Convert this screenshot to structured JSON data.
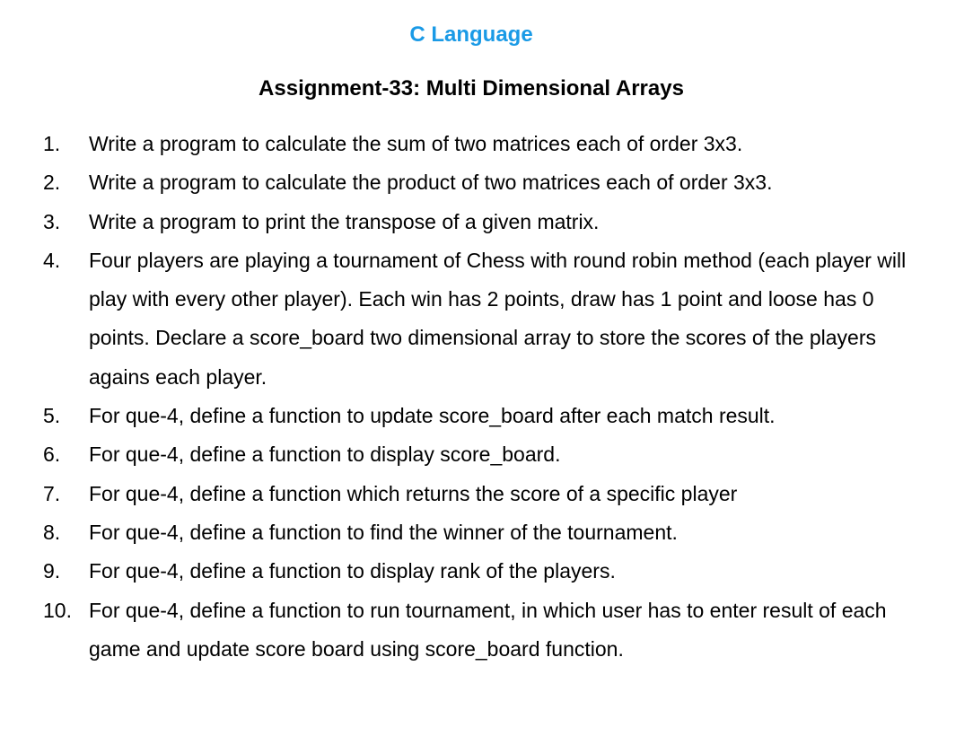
{
  "document": {
    "subject": "C Language",
    "subject_color": "#1a9ae6",
    "assignment_title": "Assignment-33: Multi Dimensional Arrays",
    "questions": [
      {
        "num": "1.",
        "text": "Write a program to calculate the sum of two matrices each of order 3x3."
      },
      {
        "num": "2.",
        "text": "Write a program to calculate the product of two matrices each of order 3x3."
      },
      {
        "num": "3.",
        "text": "Write a program to print the transpose of a given matrix."
      },
      {
        "num": "4.",
        "text": "Four players are playing a tournament of Chess with round robin method (each player will play with every other player). Each win has 2 points, draw has 1 point and loose has 0 points.  Declare a score_board two dimensional array to store the scores of the players agains each player."
      },
      {
        "num": "5.",
        "text": "For que-4, define a function to update score_board after each match result."
      },
      {
        "num": "6.",
        "text": "For que-4, define a function to display score_board."
      },
      {
        "num": "7.",
        "text": "For que-4, define a function which returns the score of a specific player"
      },
      {
        "num": "8.",
        "text": "For que-4, define a function to find the winner of the tournament."
      },
      {
        "num": "9.",
        "text": "For que-4, define a function to display rank of the players."
      },
      {
        "num": "10.",
        "text": "For que-4, define a function to run tournament, in which user has to enter result of each game and update score board using score_board function."
      }
    ]
  }
}
